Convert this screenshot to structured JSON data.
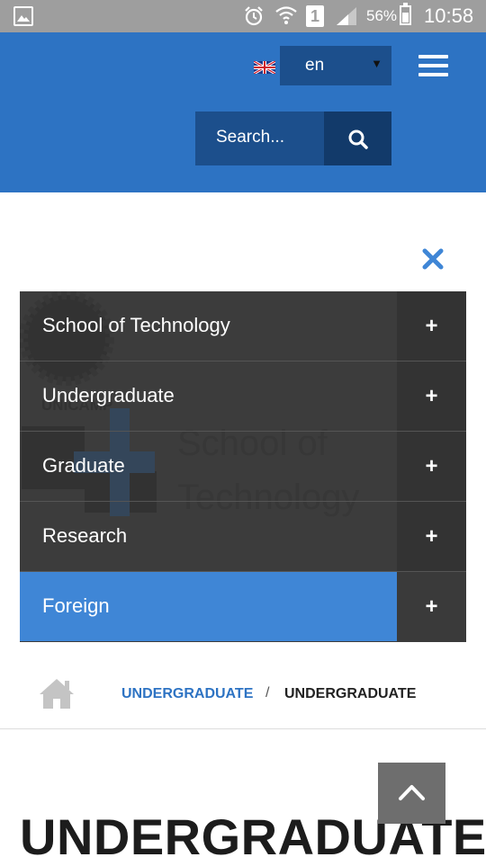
{
  "status_bar": {
    "battery_percent": "56%",
    "time": "10:58",
    "sim_slot": "1",
    "icons": [
      "gallery-icon",
      "alarm-icon",
      "wifi-icon",
      "sim-icon",
      "signal-icon",
      "battery-icon"
    ]
  },
  "header": {
    "language": {
      "flag": "uk-flag-icon",
      "value": "en"
    },
    "search": {
      "placeholder": "Search..."
    },
    "colors": {
      "header_bg": "#2d73c3",
      "control_bg": "#1c4f8c",
      "search_button_bg": "#123a6a"
    }
  },
  "menu": {
    "watermark": {
      "logo_text": "UNICAMP",
      "school_text_line1": "School of",
      "school_text_line2": "Technology"
    },
    "items": [
      {
        "label": "School of Technology",
        "expand": "+"
      },
      {
        "label": "Undergraduate",
        "expand": "+"
      },
      {
        "label": "Graduate",
        "expand": "+"
      },
      {
        "label": "Research",
        "expand": "+"
      },
      {
        "label": "Foreign",
        "expand": "+",
        "active": true
      }
    ],
    "colors": {
      "panel_bg": "#3c3c3c",
      "active_bg": "#3f86d6"
    }
  },
  "breadcrumb": {
    "link": "UNDERGRADUATE",
    "separator": "/",
    "current": "UNDERGRADUATE"
  },
  "page": {
    "title": "UNDERGRADUATE"
  }
}
